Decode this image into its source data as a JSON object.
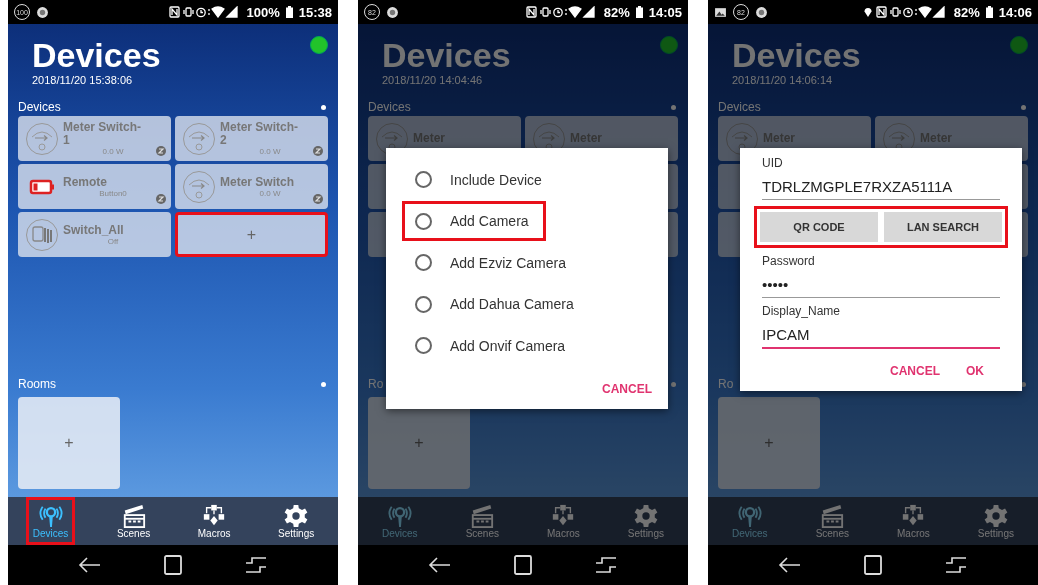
{
  "phones": [
    {
      "status_bar": {
        "left_icons": [
          {
            "kind": "badge",
            "text": "100"
          },
          {
            "kind": "app"
          }
        ],
        "location": false,
        "battery": "100%",
        "time": "15:38"
      },
      "dimmed": false,
      "online": true,
      "title": "Devices",
      "timestamp": "2018/11/20 15:38:06",
      "devices_label": "Devices",
      "devices": [
        {
          "kind": "meter",
          "name": "Meter Switch-1",
          "reading": "0.0 W",
          "zwave": true,
          "highlighted": false
        },
        {
          "kind": "meter",
          "name": "Meter Switch-2",
          "reading": "0.0 W",
          "zwave": true,
          "highlighted": false
        },
        {
          "kind": "remote",
          "name": "Remote",
          "reading": "Button0",
          "zwave": true,
          "highlighted": false
        },
        {
          "kind": "meter",
          "name": "Meter Switch",
          "reading": "0.0 W",
          "zwave": true,
          "highlighted": false
        },
        {
          "kind": "switch",
          "name": "Switch_All",
          "reading": "Off",
          "zwave": false,
          "highlighted": false
        },
        {
          "kind": "add",
          "name": "+",
          "highlighted": true
        }
      ],
      "rooms_label": "Rooms",
      "rooms": [
        {
          "label": "+"
        }
      ],
      "tabs": [
        {
          "kind": "devices",
          "label": "Devices",
          "selected": true,
          "highlighted": true
        },
        {
          "kind": "scenes",
          "label": "Scenes",
          "selected": false,
          "highlighted": false
        },
        {
          "kind": "macros",
          "label": "Macros",
          "selected": false,
          "highlighted": false
        },
        {
          "kind": "settings",
          "label": "Settings",
          "selected": false,
          "highlighted": false
        }
      ]
    },
    {
      "status_bar": {
        "left_icons": [
          {
            "kind": "badge",
            "text": "82"
          },
          {
            "kind": "app"
          }
        ],
        "location": false,
        "battery": "82%",
        "time": "14:05"
      },
      "dimmed": true,
      "online": true,
      "title": "Devices",
      "timestamp": "2018/11/20 14:04:46",
      "devices_label": "Devices",
      "devices": [
        {
          "kind": "meter",
          "name": "Meter",
          "highlighted": false
        },
        {
          "kind": "meter",
          "name": "Meter",
          "highlighted": false
        },
        {
          "kind": "blank",
          "highlighted": false
        },
        {
          "kind": "blank",
          "highlighted": false
        },
        {
          "kind": "blank",
          "highlighted": false
        },
        {
          "kind": "blank",
          "highlighted": false
        }
      ],
      "rooms_label": "Ro",
      "rooms": [
        {
          "label": "+"
        }
      ],
      "tabs": [
        {
          "kind": "devices",
          "label": "Devices",
          "selected": true,
          "highlighted": false
        },
        {
          "kind": "scenes",
          "label": "Scenes",
          "selected": false,
          "highlighted": false
        },
        {
          "kind": "macros",
          "label": "Macros",
          "selected": false,
          "highlighted": false
        },
        {
          "kind": "settings",
          "label": "Settings",
          "selected": false,
          "highlighted": false
        }
      ],
      "dialog": {
        "kind": "options",
        "options": [
          {
            "label": "Include Device",
            "selected": false,
            "highlighted": false
          },
          {
            "label": "Add Camera",
            "selected": false,
            "highlighted": true
          },
          {
            "label": "Add Ezviz Camera",
            "selected": false,
            "highlighted": false
          },
          {
            "label": "Add Dahua Camera",
            "selected": false,
            "highlighted": false
          },
          {
            "label": "Add Onvif Camera",
            "selected": false,
            "highlighted": false
          }
        ],
        "actions": [
          {
            "label": "CANCEL"
          }
        ]
      }
    },
    {
      "status_bar": {
        "left_icons": [
          {
            "kind": "image"
          },
          {
            "kind": "badge",
            "text": "82"
          },
          {
            "kind": "app"
          }
        ],
        "location": true,
        "battery": "82%",
        "time": "14:06"
      },
      "dimmed": true,
      "online": true,
      "title": "Devices",
      "timestamp": "2018/11/20 14:06:14",
      "devices_label": "Devices",
      "devices": [
        {
          "kind": "meter",
          "name": "Meter",
          "highlighted": false
        },
        {
          "kind": "meter",
          "name": "Meter",
          "highlighted": false
        },
        {
          "kind": "blank",
          "highlighted": false
        },
        {
          "kind": "blank",
          "highlighted": false
        },
        {
          "kind": "blank",
          "highlighted": false
        },
        {
          "kind": "blank",
          "highlighted": false
        }
      ],
      "rooms_label": "Ro",
      "rooms": [
        {
          "label": "+"
        }
      ],
      "tabs": [
        {
          "kind": "devices",
          "label": "Devices",
          "selected": true,
          "highlighted": false
        },
        {
          "kind": "scenes",
          "label": "Scenes",
          "selected": false,
          "highlighted": false
        },
        {
          "kind": "macros",
          "label": "Macros",
          "selected": false,
          "highlighted": false
        },
        {
          "kind": "settings",
          "label": "Settings",
          "selected": false,
          "highlighted": false
        }
      ],
      "dialog": {
        "kind": "form",
        "items": [
          {
            "kind": "field",
            "label": "UID",
            "value": "TDRLZMGPLE7RXZA5111A",
            "focused": false
          },
          {
            "kind": "buttons",
            "highlighted": true,
            "buttons": [
              "QR CODE",
              "LAN SEARCH"
            ]
          },
          {
            "kind": "field",
            "label": "Password",
            "value": "•••••",
            "focused": false
          },
          {
            "kind": "field",
            "label": "Display_Name",
            "value": "IPCAM",
            "focused": true
          }
        ],
        "actions": [
          {
            "label": "CANCEL"
          },
          {
            "label": "OK"
          }
        ]
      }
    }
  ]
}
